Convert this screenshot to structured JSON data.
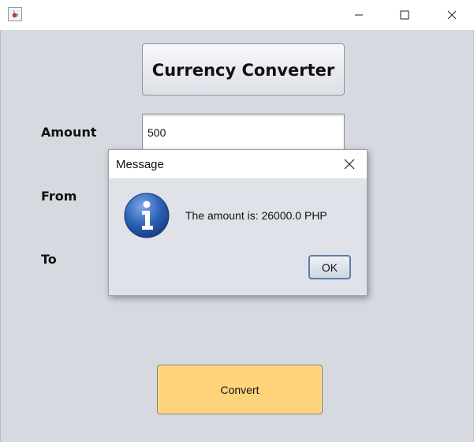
{
  "window": {
    "icon": "java-cup-icon",
    "controls": [
      "minimize-icon",
      "maximize-icon",
      "close-icon"
    ]
  },
  "form": {
    "title_button": "Currency Converter",
    "amount_label": "Amount",
    "amount_value": "500",
    "from_label": "From",
    "to_label": "To",
    "convert_button": "Convert"
  },
  "dialog": {
    "title": "Message",
    "icon": "information-icon",
    "message": "The amount is: 26000.0 PHP",
    "ok_button": "OK"
  },
  "colors": {
    "background": "#d7d9e0",
    "convert_button": "#ffd37c",
    "info_icon": "#2d62b8"
  }
}
